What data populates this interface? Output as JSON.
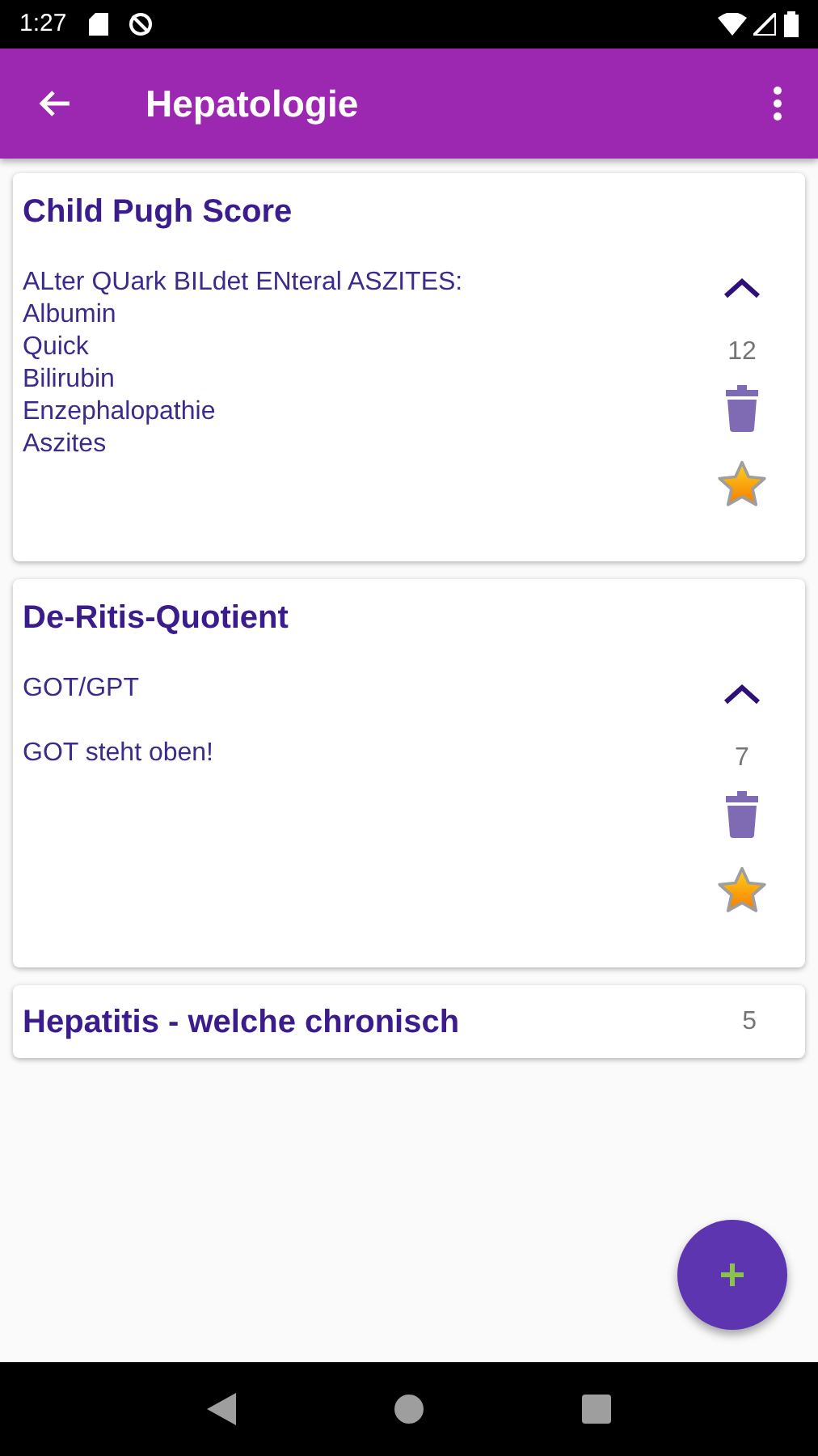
{
  "status_bar": {
    "time": "1:27"
  },
  "app_bar": {
    "title": "Hepatologie"
  },
  "cards": [
    {
      "title": "Child Pugh Score",
      "expanded": true,
      "count": "12",
      "favorite": true,
      "paragraphs": [
        [
          "ALter QUark BILdet ENteral ASZITES:",
          "Albumin",
          "Quick",
          "Bilirubin",
          "Enzephalopathie",
          "Aszites"
        ]
      ]
    },
    {
      "title": "De-Ritis-Quotient",
      "expanded": true,
      "count": "7",
      "favorite": true,
      "paragraphs": [
        [
          "GOT/GPT"
        ],
        [
          "GOT steht oben!"
        ]
      ]
    },
    {
      "title": "Hepatitis - welche chronisch",
      "expanded": false,
      "count": "5",
      "favorite": false
    }
  ]
}
